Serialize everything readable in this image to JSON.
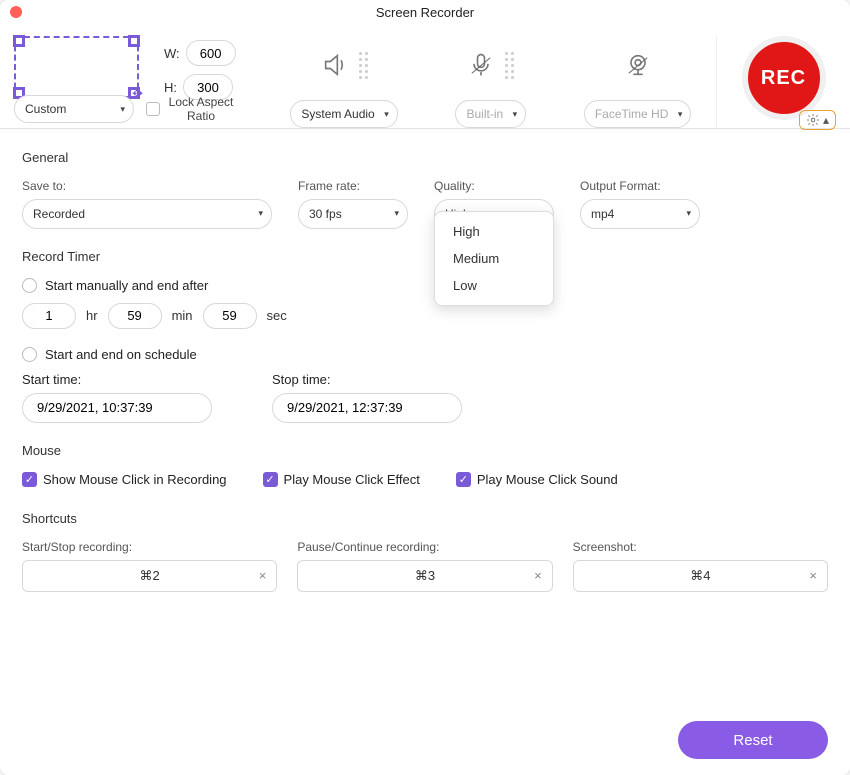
{
  "window": {
    "title": "Screen Recorder"
  },
  "area": {
    "width": "600",
    "height": "300",
    "width_label": "W:",
    "height_label": "H:",
    "preset": "Custom",
    "lock_aspect_label": "Lock Aspect Ratio",
    "lock_aspect_checked": false
  },
  "sources": {
    "system_audio": {
      "label": "System Audio"
    },
    "mic": {
      "label": "Built-in"
    },
    "camera": {
      "label": "FaceTime HD"
    }
  },
  "rec_label": "REC",
  "general": {
    "heading": "General",
    "save_to_label": "Save to:",
    "save_to_value": "Recorded",
    "frame_rate_label": "Frame rate:",
    "frame_rate_value": "30 fps",
    "quality_label": "Quality:",
    "quality_value": "High",
    "quality_options": [
      "High",
      "Medium",
      "Low"
    ],
    "output_label": "Output Format:",
    "output_value": "mp4"
  },
  "timer": {
    "heading": "Record Timer",
    "manual_label": "Start manually and end after",
    "hr": "1",
    "hr_label": "hr",
    "min": "59",
    "min_label": "min",
    "sec": "59",
    "sec_label": "sec",
    "schedule_label": "Start and end on schedule",
    "start_label": "Start time:",
    "stop_label": "Stop time:",
    "start_value": "9/29/2021, 10:37:39",
    "stop_value": "9/29/2021, 12:37:39"
  },
  "mouse": {
    "heading": "Mouse",
    "opt1": "Show Mouse Click in Recording",
    "opt2": "Play Mouse Click Effect",
    "opt3": "Play Mouse Click Sound"
  },
  "shortcuts": {
    "heading": "Shortcuts",
    "startstop_label": "Start/Stop recording:",
    "startstop_value": "⌘2",
    "pause_label": "Pause/Continue recording:",
    "pause_value": "⌘3",
    "screenshot_label": "Screenshot:",
    "screenshot_value": "⌘4"
  },
  "footer": {
    "reset_label": "Reset"
  }
}
